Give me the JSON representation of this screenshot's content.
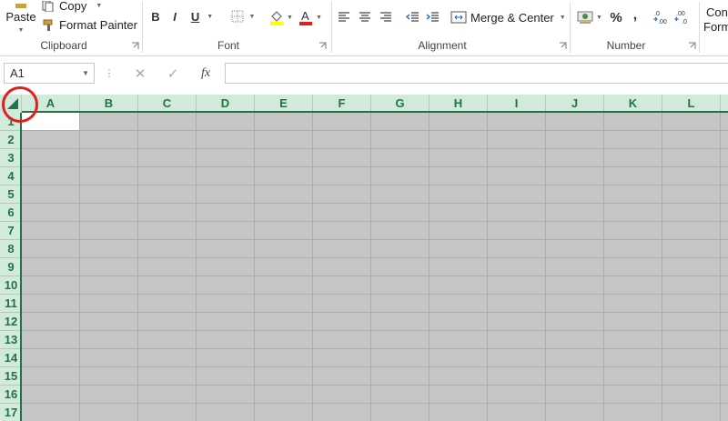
{
  "ribbon": {
    "clipboard": {
      "paste_label": "Paste",
      "copy_label": "Copy",
      "format_painter_label": "Format Painter",
      "group_label": "Clipboard"
    },
    "font": {
      "bold": "B",
      "italic": "I",
      "underline": "U",
      "group_label": "Font"
    },
    "alignment": {
      "merge_center_label": "Merge & Center",
      "group_label": "Alignment"
    },
    "number": {
      "percent": "%",
      "comma": ",",
      "group_label": "Number"
    },
    "styles": {
      "conditional_line1": "Conc",
      "conditional_line2": "Form"
    },
    "colors": {
      "fill_color": "#ffff00",
      "font_color": "#e02020"
    }
  },
  "formula_bar": {
    "name_box_value": "A1",
    "fx_label": "fx",
    "formula_value": ""
  },
  "sheet": {
    "columns": [
      "A",
      "B",
      "C",
      "D",
      "E",
      "F",
      "G",
      "H",
      "I",
      "J",
      "K",
      "L"
    ],
    "rows": [
      "1",
      "2",
      "3",
      "4",
      "5",
      "6",
      "7",
      "8",
      "9",
      "10",
      "11",
      "12",
      "13",
      "14",
      "15",
      "16",
      "17"
    ],
    "active_cell": "A1",
    "header_color": "#217346",
    "selection_color": "#c6c6c6"
  }
}
